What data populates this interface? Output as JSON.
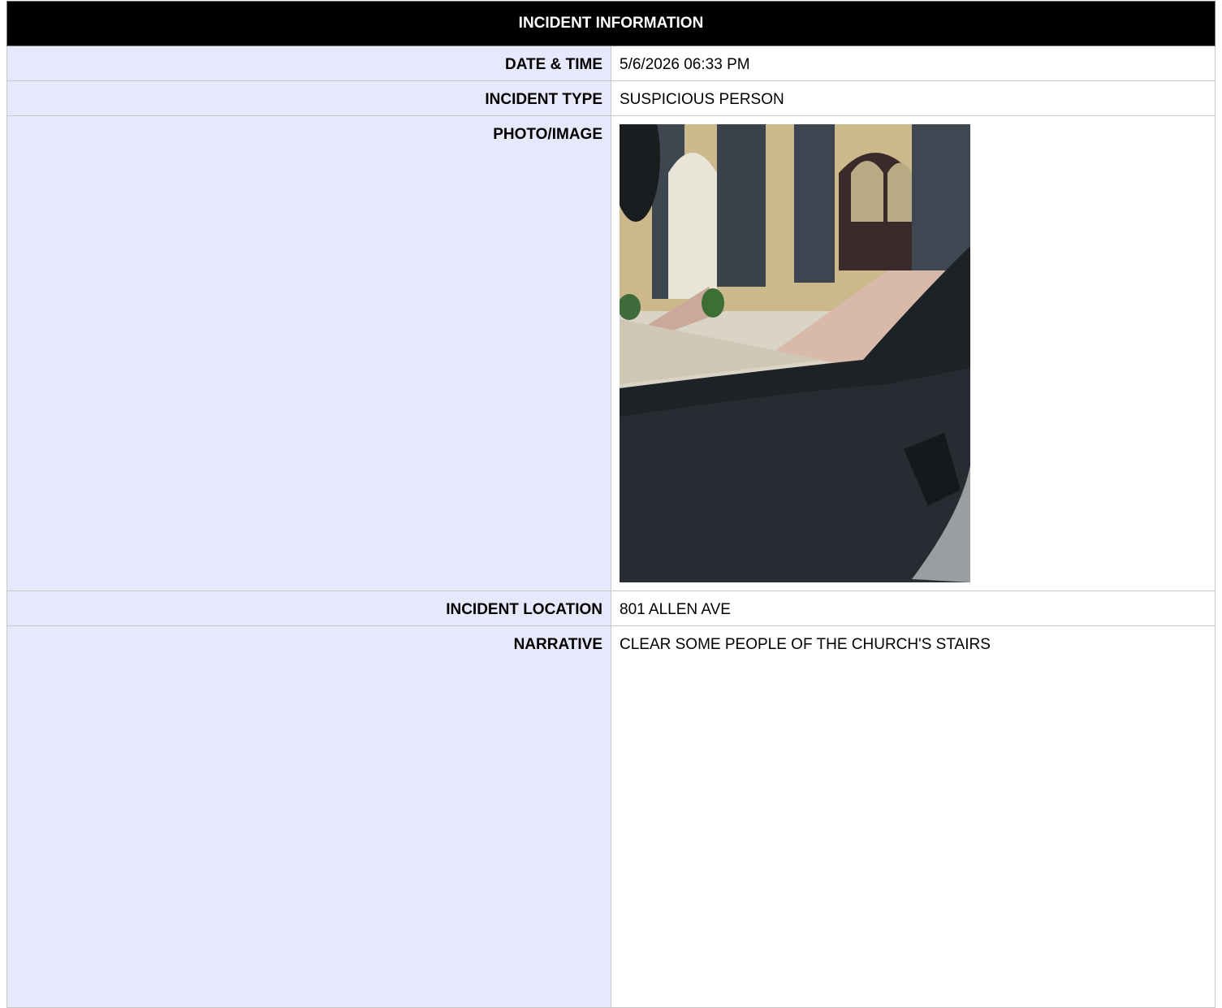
{
  "header": {
    "title": "INCIDENT INFORMATION"
  },
  "fields": {
    "datetime": {
      "label": "DATE & TIME",
      "value": "5/6/2026 06:33 PM"
    },
    "type": {
      "label": "INCIDENT TYPE",
      "value": "SUSPICIOUS PERSON"
    },
    "photo": {
      "label": "PHOTO/IMAGE"
    },
    "location": {
      "label": "INCIDENT LOCATION",
      "value": "801 ALLEN AVE"
    },
    "narrative": {
      "label": "NARRATIVE",
      "value": "CLEAR SOME PEOPLE OF THE CHURCH'S STAIRS"
    }
  },
  "colors": {
    "header_bg": "#000000",
    "label_bg": "#e8e8fc",
    "border": "#c8c8c8"
  }
}
